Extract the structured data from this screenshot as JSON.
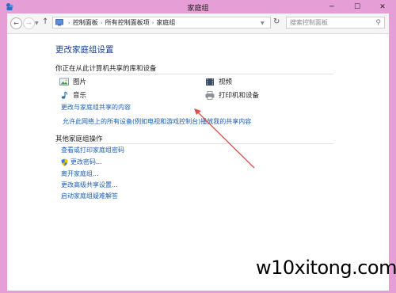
{
  "window": {
    "title": "家庭组"
  },
  "addressbar": {
    "breadcrumbs": [
      "控制面板",
      "所有控制面板项",
      "家庭组"
    ],
    "search_placeholder": "搜索控制面板"
  },
  "main": {
    "title": "更改家庭组设置",
    "share_section": {
      "heading": "你正在从此计算机共享的库和设备",
      "items": [
        {
          "label": "图片",
          "icon": "pictures-icon"
        },
        {
          "label": "视频",
          "icon": "videos-icon"
        },
        {
          "label": "音乐",
          "icon": "music-icon"
        },
        {
          "label": "打印机和设备",
          "icon": "printer-icon"
        }
      ],
      "change_share_link": "更改与家庭组共享的内容",
      "stream_link": "允许此网络上的所有设备(例如电视和游戏控制台)播放我的共享内容"
    },
    "other_section": {
      "heading": "其他家庭组操作",
      "links": [
        "查看或打印家庭组密码",
        "更改密码...",
        "离开家庭组...",
        "更改高级共享设置...",
        "启动家庭组疑难解答"
      ]
    }
  },
  "watermark": "w10xitong.com",
  "colors": {
    "link": "#1a5fb4",
    "title": "#1a3e8c",
    "border": "#e69fd6",
    "arrow": "#d9534f"
  }
}
